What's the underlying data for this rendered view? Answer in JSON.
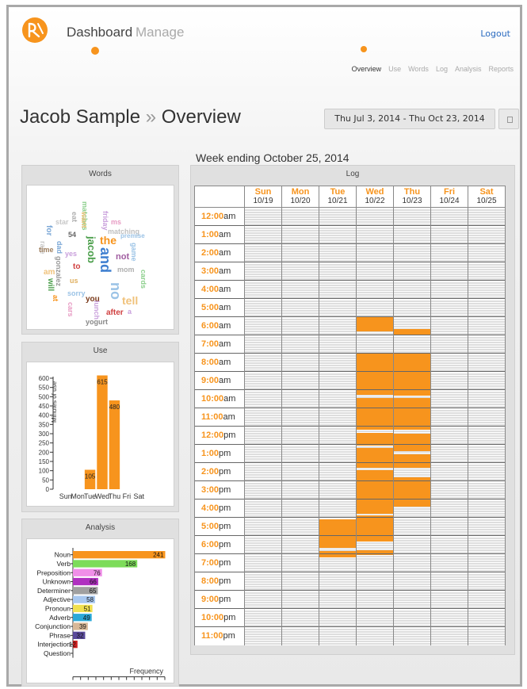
{
  "nav": {
    "dashboard": "Dashboard",
    "manage": "Manage",
    "logout": "Logout",
    "tabs": [
      "Overview",
      "Use",
      "Words",
      "Log",
      "Analysis",
      "Reports"
    ]
  },
  "header": {
    "name": "Jacob Sample",
    "separator": "»",
    "section": "Overview",
    "date_range": "Thu Jul 3, 2014 - Thu Oct 23, 2014"
  },
  "week_title": "Week ending October 25, 2014",
  "colors": {
    "accent": "#f7941d",
    "link": "#2a6bc0"
  },
  "words_panel": {
    "title": "Words",
    "words": [
      {
        "t": "friday",
        "c": "#c9a0dc",
        "v": 1
      },
      {
        "t": "ms",
        "c": "#e79bc3",
        "v": 0
      },
      {
        "t": "star",
        "c": "#c8c8c8",
        "v": 0
      },
      {
        "t": "matches",
        "c": "#8ccf8c",
        "v": 1
      },
      {
        "t": "matching",
        "c": "#c0c0c0",
        "v": 0
      },
      {
        "t": "eat",
        "c": "#b0b0b0",
        "v": 1
      },
      {
        "t": "want",
        "c": "#f0c27b",
        "v": 1
      },
      {
        "t": "the",
        "c": "#f7941d",
        "v": 0
      },
      {
        "t": "premise",
        "c": "#9bc3e6",
        "v": 0
      },
      {
        "t": "for",
        "c": "#7aa7d6",
        "v": 1
      },
      {
        "t": "54",
        "c": "#666666",
        "v": 0
      },
      {
        "t": "rate",
        "c": "#c8c8c8",
        "v": 1
      },
      {
        "t": "dad",
        "c": "#7aa7d6",
        "v": 1
      },
      {
        "t": "jacob",
        "c": "#4a9e4a",
        "v": 1
      },
      {
        "t": "game",
        "c": "#9bc3e6",
        "v": 1
      },
      {
        "t": "time",
        "c": "#a08060",
        "v": 0
      },
      {
        "t": "yes",
        "c": "#c9a0dc",
        "v": 0
      },
      {
        "t": "not",
        "c": "#a05ca0",
        "v": 0
      },
      {
        "t": "gonzalez",
        "c": "#999999",
        "v": 1
      },
      {
        "t": "and",
        "c": "#3f7fd0",
        "v": 1
      },
      {
        "t": "am",
        "c": "#f0c27b",
        "v": 0
      },
      {
        "t": "to",
        "c": "#d04040",
        "v": 0
      },
      {
        "t": "mom",
        "c": "#b0b0b0",
        "v": 0
      },
      {
        "t": "will",
        "c": "#4a9e4a",
        "v": 1
      },
      {
        "t": "us",
        "c": "#e0b060",
        "v": 0
      },
      {
        "t": "cards",
        "c": "#8ccf8c",
        "v": 1
      },
      {
        "t": "no",
        "c": "#9bc3e6",
        "v": 1
      },
      {
        "t": "tell",
        "c": "#f0c27b",
        "v": 0
      },
      {
        "t": "sorry",
        "c": "#9bc3e6",
        "v": 0
      },
      {
        "t": "at",
        "c": "#f7941d",
        "v": 1
      },
      {
        "t": "you",
        "c": "#7a3a1a",
        "v": 0
      },
      {
        "t": "cars",
        "c": "#e79bc3",
        "v": 1
      },
      {
        "t": "lunch",
        "c": "#c9a0dc",
        "v": 1
      },
      {
        "t": "after",
        "c": "#d04040",
        "v": 0
      },
      {
        "t": "a",
        "c": "#c9a0dc",
        "v": 0
      },
      {
        "t": "yogurt",
        "c": "#888888",
        "v": 0
      }
    ]
  },
  "use_panel": {
    "title": "Use",
    "chart_data": {
      "type": "bar",
      "categories": [
        "Sun",
        "Mon",
        "Tue",
        "Wed",
        "Thu",
        "Fri",
        "Sat"
      ],
      "values": [
        0,
        0,
        105,
        615,
        480,
        0,
        0
      ],
      "data_labels": [
        "",
        "",
        "105",
        "615",
        "480",
        "",
        ""
      ],
      "ylabel": "Minutes of use",
      "ylim": [
        0,
        600
      ],
      "yticks": [
        "0",
        "50",
        "100",
        "150",
        "200",
        "250",
        "300",
        "350",
        "400",
        "450",
        "500",
        "550",
        "600"
      ]
    }
  },
  "analysis_panel": {
    "title": "Analysis",
    "chart_data": {
      "type": "bar",
      "orientation": "horizontal",
      "categories": [
        "Noun",
        "Verb",
        "Preposition",
        "Unknown",
        "Determiner",
        "Adjective",
        "Pronoun",
        "Adverb",
        "Conjunction",
        "Phrase",
        "Interjection",
        "Question"
      ],
      "values": [
        241,
        168,
        76,
        66,
        65,
        58,
        51,
        49,
        39,
        32,
        12,
        0
      ],
      "data_labels": [
        "241",
        "168",
        "76",
        "66",
        "65",
        "58",
        "51",
        "49",
        "39",
        "32",
        "12",
        ""
      ],
      "colors": [
        "#f7941d",
        "#7ddc5a",
        "#f08fe8",
        "#b030c0",
        "#a0a0a0",
        "#a8c8f0",
        "#f0e050",
        "#2aa8d8",
        "#d8b898",
        "#5a4a9a",
        "#d02020",
        "#888888"
      ],
      "xlabel": "Frequency",
      "xlim": [
        0,
        240
      ],
      "xticks": [
        "0",
        "20",
        "40",
        "60",
        "80",
        "100",
        "120",
        "140",
        "160",
        "180",
        "200",
        "220",
        "240"
      ]
    }
  },
  "log_panel": {
    "title": "Log",
    "days": [
      {
        "name": "Sun",
        "date": "10/19"
      },
      {
        "name": "Mon",
        "date": "10/20"
      },
      {
        "name": "Tue",
        "date": "10/21"
      },
      {
        "name": "Wed",
        "date": "10/22"
      },
      {
        "name": "Thu",
        "date": "10/23"
      },
      {
        "name": "Fri",
        "date": "10/24"
      },
      {
        "name": "Sat",
        "date": "10/25"
      }
    ],
    "hours": [
      {
        "h": "12:00",
        "s": "am"
      },
      {
        "h": "1:00",
        "s": "am"
      },
      {
        "h": "2:00",
        "s": "am"
      },
      {
        "h": "3:00",
        "s": "am"
      },
      {
        "h": "4:00",
        "s": "am"
      },
      {
        "h": "5:00",
        "s": "am"
      },
      {
        "h": "6:00",
        "s": "am"
      },
      {
        "h": "7:00",
        "s": "am"
      },
      {
        "h": "8:00",
        "s": "am"
      },
      {
        "h": "9:00",
        "s": "am"
      },
      {
        "h": "10:00",
        "s": "am"
      },
      {
        "h": "11:00",
        "s": "am"
      },
      {
        "h": "12:00",
        "s": "pm"
      },
      {
        "h": "1:00",
        "s": "pm"
      },
      {
        "h": "2:00",
        "s": "pm"
      },
      {
        "h": "3:00",
        "s": "pm"
      },
      {
        "h": "4:00",
        "s": "pm"
      },
      {
        "h": "5:00",
        "s": "pm"
      },
      {
        "h": "6:00",
        "s": "pm"
      },
      {
        "h": "7:00",
        "s": "pm"
      },
      {
        "h": "8:00",
        "s": "pm"
      },
      {
        "h": "9:00",
        "s": "pm"
      },
      {
        "h": "10:00",
        "s": "pm"
      },
      {
        "h": "11:00",
        "s": "pm"
      }
    ],
    "activity": [
      {
        "day": 2,
        "start": 17.1,
        "end": 18.7
      },
      {
        "day": 2,
        "start": 18.85,
        "end": 19.2
      },
      {
        "day": 3,
        "start": 6.0,
        "end": 6.8
      },
      {
        "day": 3,
        "start": 8.0,
        "end": 10.25
      },
      {
        "day": 3,
        "start": 10.45,
        "end": 12.2
      },
      {
        "day": 3,
        "start": 12.35,
        "end": 13.05
      },
      {
        "day": 3,
        "start": 13.2,
        "end": 14.25
      },
      {
        "day": 3,
        "start": 14.4,
        "end": 16.8
      },
      {
        "day": 3,
        "start": 16.9,
        "end": 18.3
      },
      {
        "day": 3,
        "start": 18.8,
        "end": 19.05
      },
      {
        "day": 4,
        "start": 6.7,
        "end": 7.0
      },
      {
        "day": 4,
        "start": 8.0,
        "end": 10.3
      },
      {
        "day": 4,
        "start": 10.45,
        "end": 12.2
      },
      {
        "day": 4,
        "start": 12.4,
        "end": 13.35
      },
      {
        "day": 4,
        "start": 13.55,
        "end": 14.25
      },
      {
        "day": 4,
        "start": 14.8,
        "end": 16.4
      }
    ]
  }
}
